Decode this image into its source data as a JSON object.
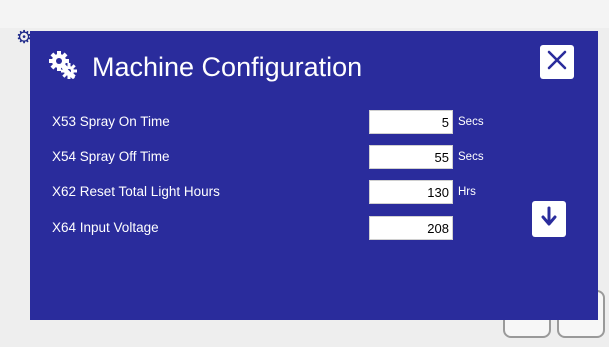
{
  "dialog": {
    "title": "Machine Configuration",
    "title_icon": "gears-icon",
    "close_icon": "close-icon",
    "scroll_down_icon": "arrow-down-icon"
  },
  "settings": [
    {
      "label": "X53 Spray On Time",
      "value": "5",
      "unit": "Secs"
    },
    {
      "label": "X54 Spray Off Time",
      "value": "55",
      "unit": "Secs"
    },
    {
      "label": "X62 Reset Total Light Hours",
      "value": "130",
      "unit": "Hrs"
    },
    {
      "label": "X64 Input Voltage",
      "value": "208",
      "unit": ""
    }
  ],
  "colors": {
    "dialog_bg": "#2a2c9c",
    "text": "#ffffff",
    "field_bg": "#ffffff"
  }
}
